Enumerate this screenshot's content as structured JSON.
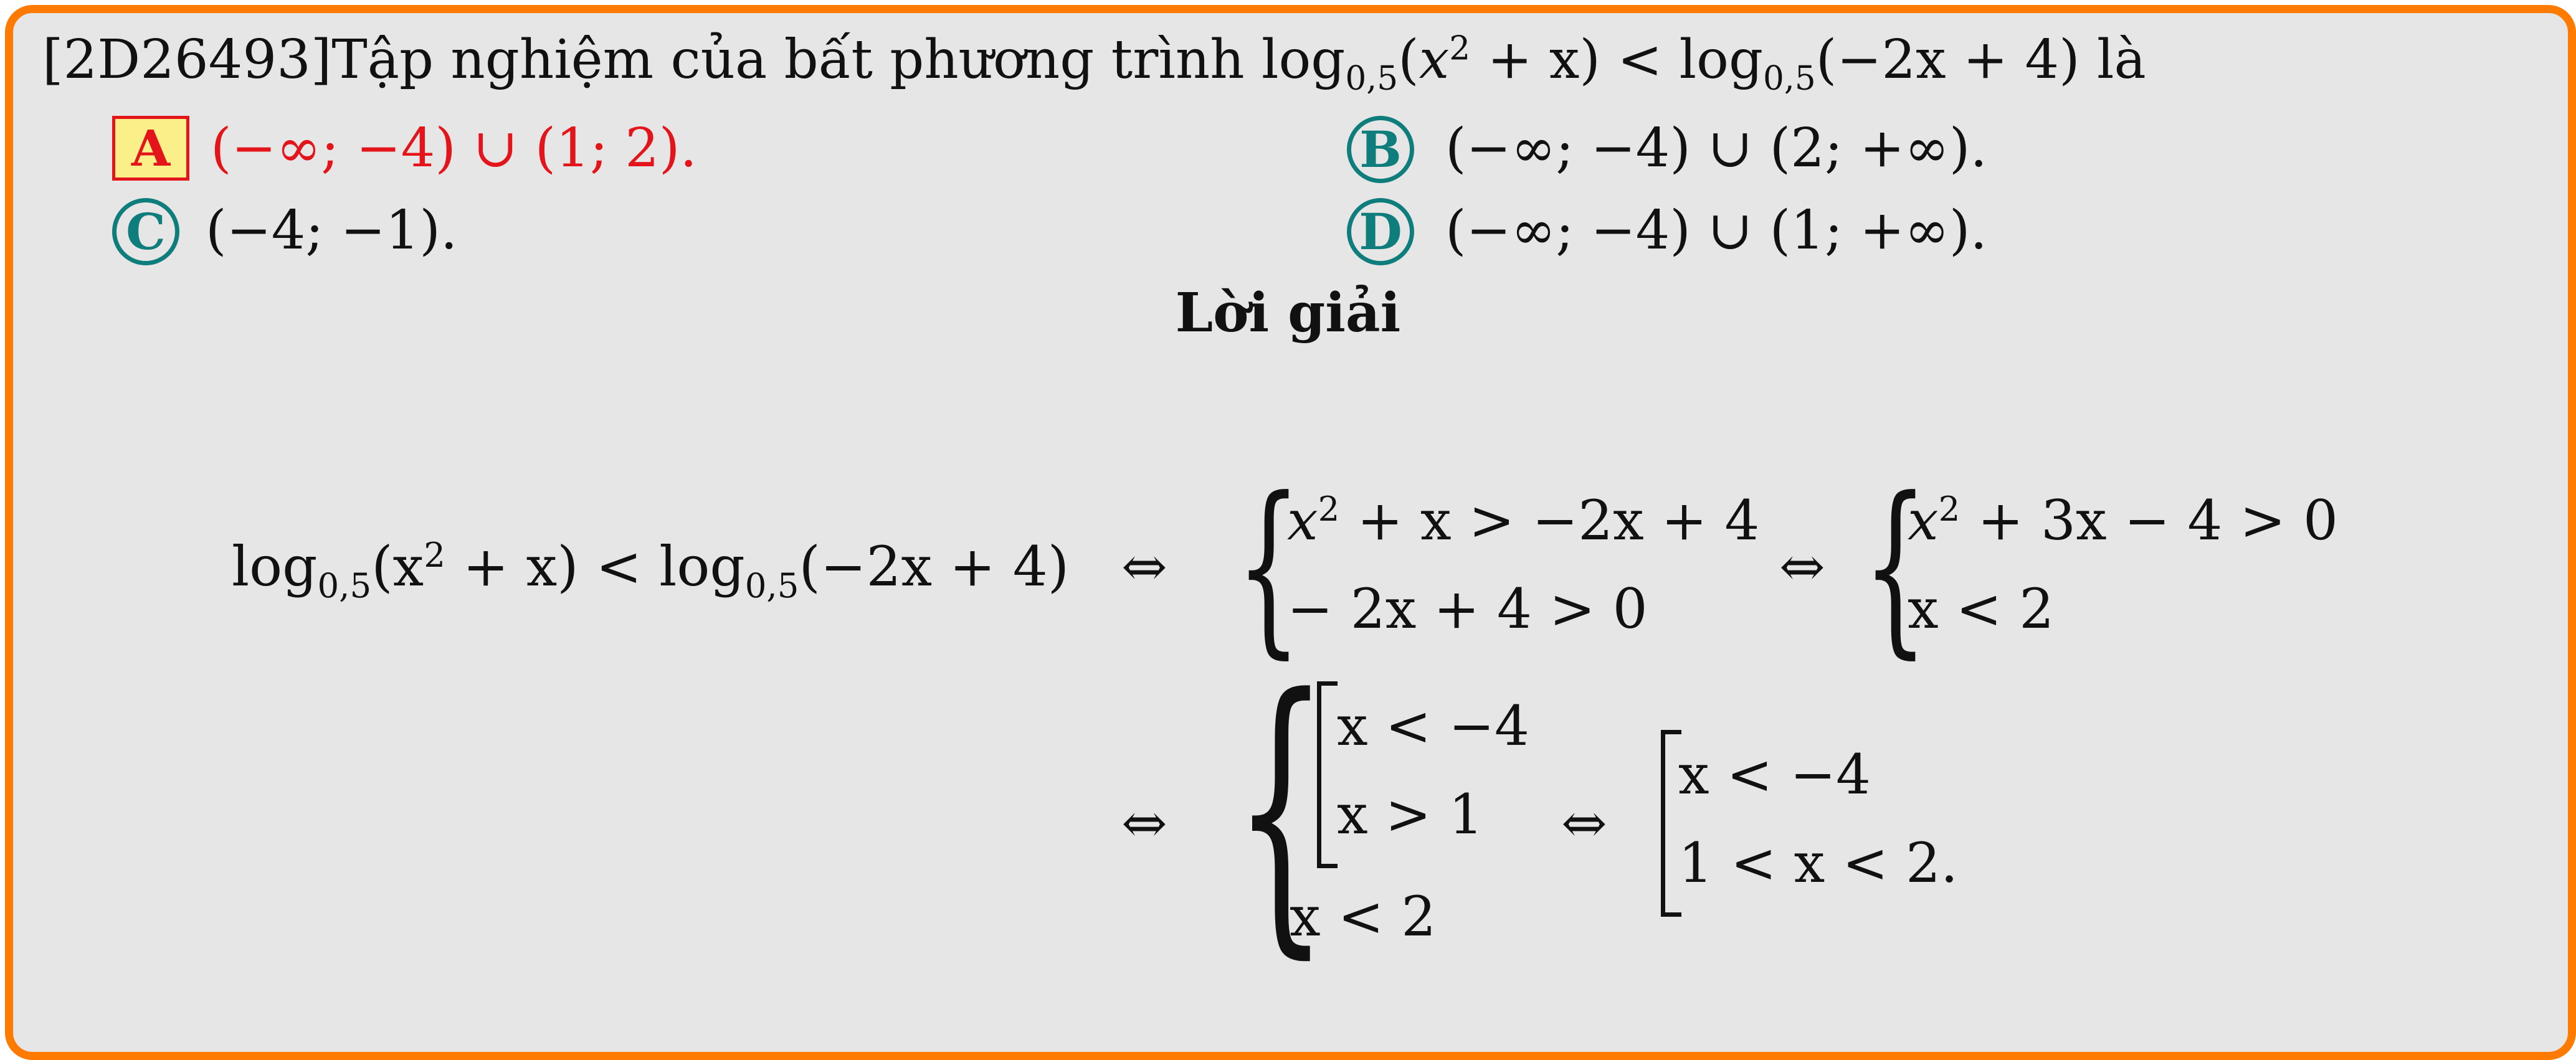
{
  "question": {
    "id": "[2D26493]",
    "text": "Tập nghiệm của bất phương trình",
    "log_base": "0,5",
    "lhs_arg_open": "(",
    "lhs_arg_x": "x",
    "lhs_arg_exp": "2",
    "lhs_arg_rest": " + x)",
    "relation": " < ",
    "rhs_arg": "(−2x + 4)",
    "suffix": "là"
  },
  "choices": [
    {
      "label": "A",
      "text": "(−∞; −4) ∪ (1; 2).",
      "correct": true
    },
    {
      "label": "B",
      "text": "(−∞; −4) ∪ (2; +∞).",
      "correct": false
    },
    {
      "label": "C",
      "text": "(−4; −1).",
      "correct": false
    },
    {
      "label": "D",
      "text": "(−∞; −4) ∪ (1; +∞).",
      "correct": false
    }
  ],
  "solution": {
    "title": "Lời giải",
    "line1": {
      "lhs": "log",
      "base": "0,5",
      "arg1_open": "(x",
      "arg1_exp": "2",
      "arg1_close": " + x) < log",
      "arg2": "(−2x + 4)",
      "iff": "⇔",
      "sys1_row1_pre": "x",
      "sys1_row1_exp": "2",
      "sys1_row1_post": " + x > −2x + 4",
      "sys1_row2": " − 2x + 4 > 0",
      "sys2_row1_pre": "x",
      "sys2_row1_exp": "2",
      "sys2_row1_post": " + 3x − 4 > 0",
      "sys2_row2": "x < 2"
    },
    "line2": {
      "iff": "⇔",
      "inner_row1": "x < −4",
      "inner_row2": "x > 1",
      "outer_row3": "x < 2",
      "result_row1": "x < −4",
      "result_row2": "1 < x < 2."
    }
  },
  "colors": {
    "border": "#ff7a00",
    "background": "#e6e6e6",
    "correct": "#e3151a",
    "correct_fill": "#fbef8a",
    "choice_accent": "#0e7d7c"
  }
}
